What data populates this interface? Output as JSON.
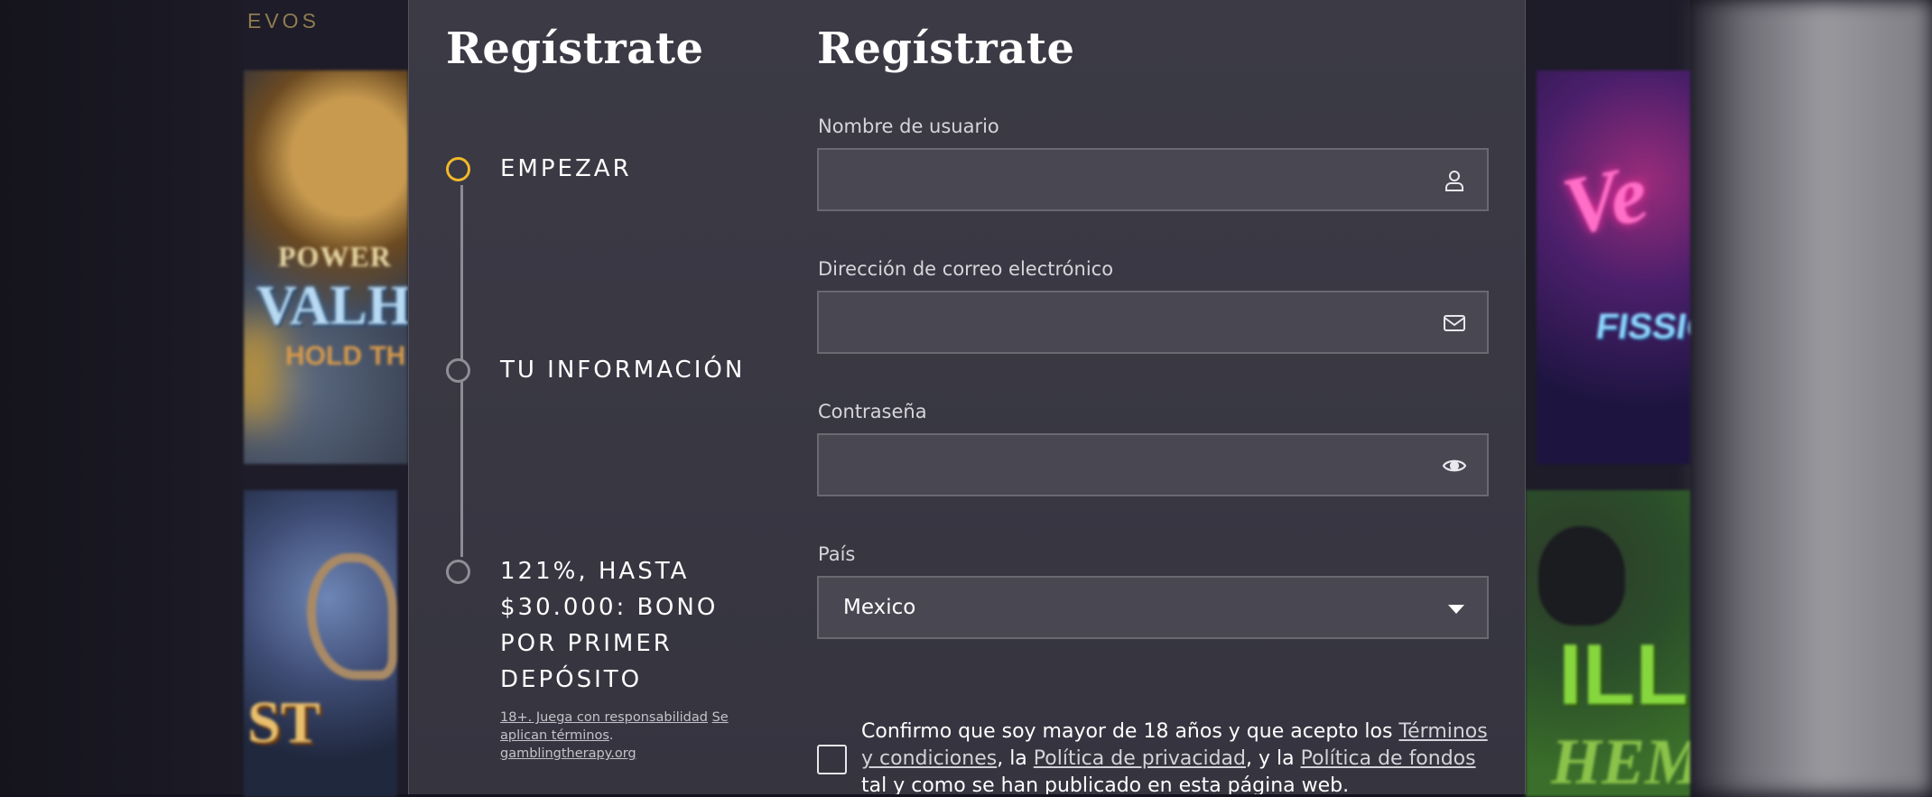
{
  "background": {
    "label": "EVOS",
    "tiles": [
      {
        "id": "valhalla",
        "line1": "POWER",
        "line2": "VALH",
        "line3": "HOLD TH"
      },
      {
        "id": "quest",
        "text": "ST"
      },
      {
        "id": "vegas",
        "line1": "Ve",
        "line2": "FISSIO"
      },
      {
        "id": "gorilla",
        "line1": "ILLA",
        "line2": "HEM"
      }
    ]
  },
  "modal": {
    "left_title": "Regístrate",
    "right_title": "Regístrate",
    "steps": [
      {
        "label": "EMPEZAR",
        "active": true
      },
      {
        "label": "TU INFORMACIÓN",
        "active": false
      },
      {
        "label": "121%, HASTA $30.000: BONO POR PRIMER DEPÓSITO",
        "active": false
      }
    ],
    "bonus_terms": {
      "link1": "18+. Juega con responsabilidad",
      "link2": "Se aplican términos",
      "link3": "gamblingtherapy.org"
    },
    "form": {
      "username": {
        "label": "Nombre de usuario",
        "value": "",
        "icon": "user-icon"
      },
      "email": {
        "label": "Dirección de correo electrónico",
        "value": "",
        "icon": "mail-icon"
      },
      "password": {
        "label": "Contraseña",
        "value": "",
        "icon": "eye-icon"
      },
      "country": {
        "label": "País",
        "selected": "Mexico"
      }
    },
    "consent": {
      "checked": false,
      "text_before": "Confirmo que soy mayor de 18 años y que acepto los ",
      "link_terms": "Términos y condiciones",
      "sep1": ", la ",
      "link_privacy": "Política de privacidad",
      "sep2": ", y la ",
      "link_funds": "Política de fondos",
      "text_after": " tal y como se han publicado en esta página web."
    }
  },
  "colors": {
    "accent": "#f1b928",
    "modal_bg": "#3a3944",
    "field_bg": "#484752"
  }
}
